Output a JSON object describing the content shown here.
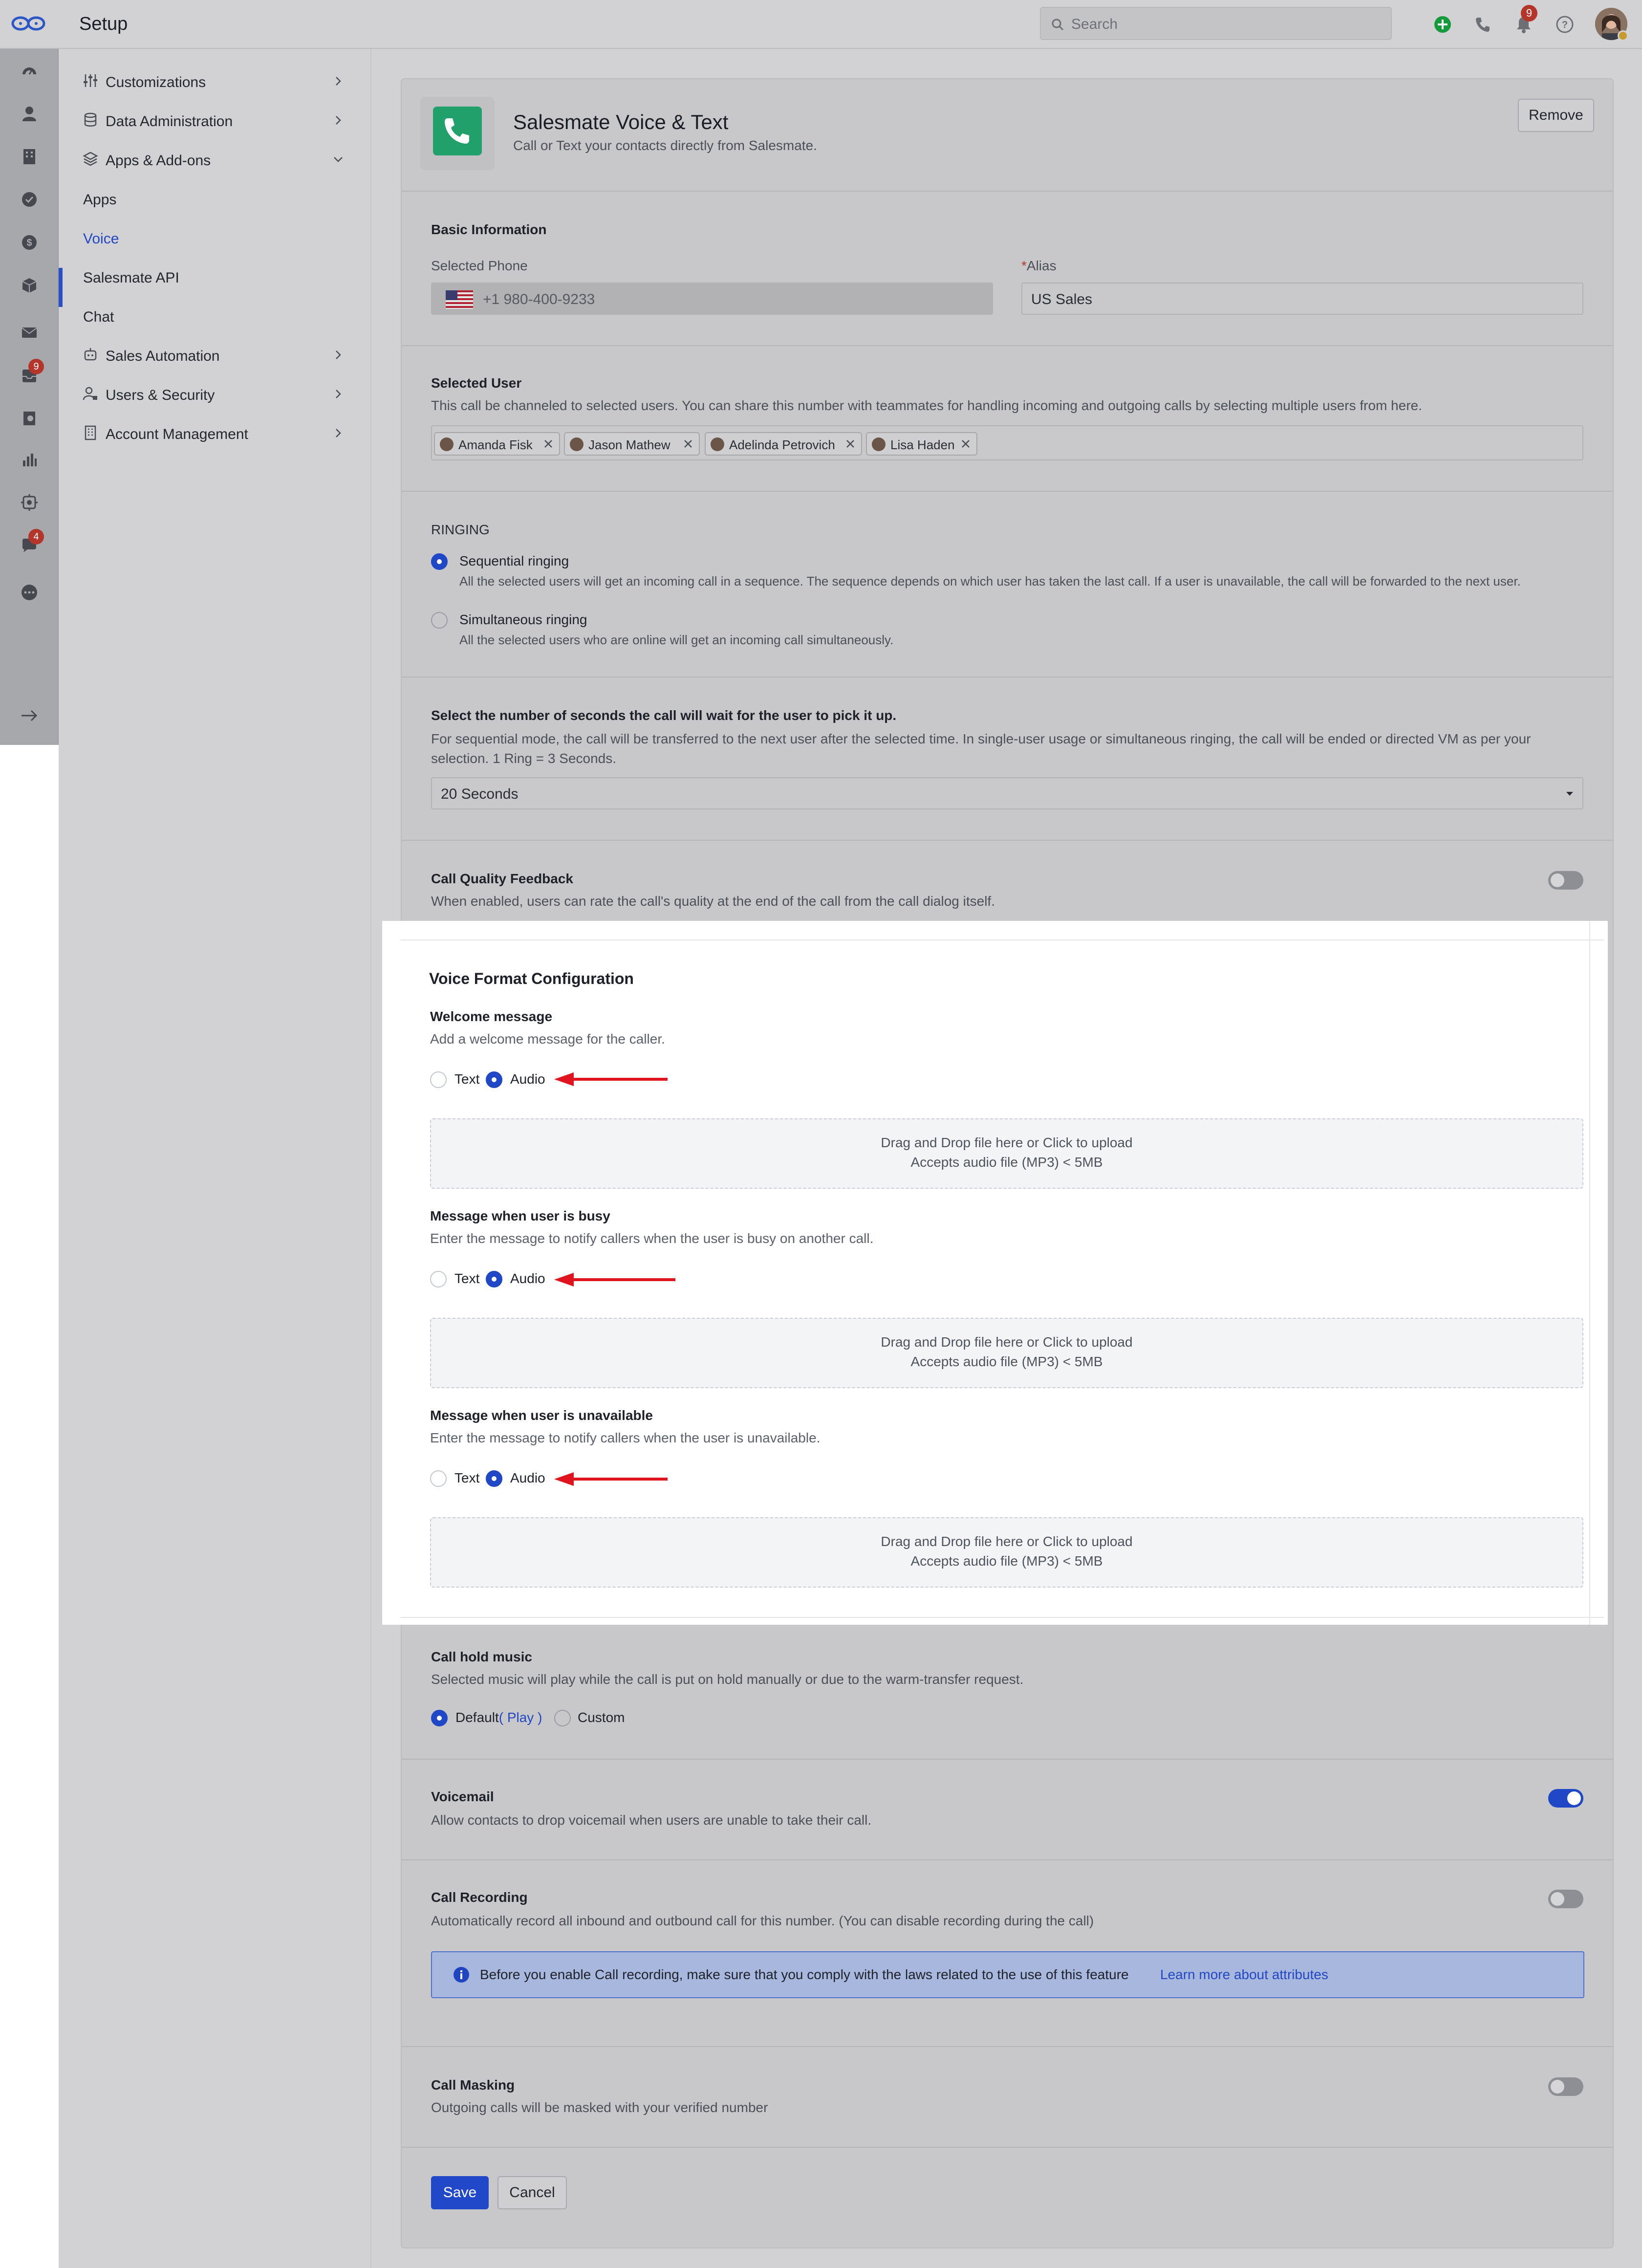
{
  "header": {
    "title": "Setup",
    "search_placeholder": "Search",
    "notification_count": "9"
  },
  "rail": {
    "badges": {
      "mail_count": "9",
      "chat_count": "4"
    }
  },
  "nav": {
    "items": [
      {
        "label": "Customizations",
        "icon": "sliders-icon"
      },
      {
        "label": "Data Administration",
        "icon": "database-icon"
      },
      {
        "label": "Apps & Add-ons",
        "icon": "layers-icon"
      },
      {
        "label": "Sales Automation",
        "icon": "robot-icon"
      },
      {
        "label": "Users & Security",
        "icon": "user-lock-icon"
      },
      {
        "label": "Account Management",
        "icon": "building-icon"
      }
    ],
    "sub_items": [
      "Apps",
      "Voice",
      "Salesmate API",
      "Chat"
    ]
  },
  "app": {
    "name": "Salesmate Voice & Text",
    "description": "Call or Text your contacts directly from Salesmate.",
    "remove_label": "Remove",
    "icon_color": "#22a06b"
  },
  "basic_info": {
    "title": "Basic Information",
    "phone_label": "Selected Phone",
    "phone_value": "+1 980-400-9233",
    "alias_required_mark": "*",
    "alias_label": "Alias",
    "alias_value": "US Sales"
  },
  "selected_user": {
    "title": "Selected User",
    "description": "This call be channeled to selected users. You can share this number with teammates for handling incoming and outgoing calls by selecting multiple users from here.",
    "users": [
      "Amanda Fisk",
      "Jason Mathew",
      "Adelinda Petrovich",
      "Lisa Haden"
    ]
  },
  "ringing": {
    "title": "RINGING",
    "options": [
      {
        "label": "Sequential ringing",
        "description": "All the selected users will get an incoming call in a sequence. The sequence depends on which user has taken the last call. If a user is unavailable, the call will be forwarded to the next user.",
        "selected": true
      },
      {
        "label": "Simultaneous ringing",
        "description": "All the selected users who are online will get an incoming call simultaneously.",
        "selected": false
      }
    ]
  },
  "wait_time": {
    "title": "Select the number of seconds the call will wait for the user to pick it up.",
    "description_line1": "For sequential mode, the call will be transferred to the next user after the selected time. In single-user usage or simultaneous ringing, the call will be ended or directed VM as per your",
    "description_line2": "selection. 1 Ring = 3 Seconds.",
    "selected": "20 Seconds"
  },
  "call_quality": {
    "title": "Call Quality Feedback",
    "description": "When enabled, users can rate the call's quality at the end of the call from the call dialog itself.",
    "enabled": false
  },
  "voice_format": {
    "title": "Voice Format Configuration",
    "text_label": "Text",
    "audio_label": "Audio",
    "dropzone_line1": "Drag and Drop file here or Click to upload",
    "dropzone_line2": "Accepts audio file (MP3) < 5MB",
    "messages": [
      {
        "title": "Welcome message",
        "description": "Add a welcome message for the caller.",
        "selected": "Audio"
      },
      {
        "title": "Message when user is busy",
        "description": "Enter the message to notify callers when the user is busy on another call.",
        "selected": "Audio"
      },
      {
        "title": "Message when user is unavailable",
        "description": "Enter the message to notify callers when the user is unavailable.",
        "selected": "Audio"
      }
    ],
    "annotation_color": "#e0141e"
  },
  "hold_music": {
    "title": "Call hold music",
    "description": "Selected music will play while the call is put on hold manually or due to the warm-transfer request.",
    "default_label": "Default",
    "play_open": "(",
    "play_label": "Play",
    "play_close": ")",
    "custom_label": "Custom",
    "selected": "Default"
  },
  "voicemail": {
    "title": "Voicemail",
    "description": "Allow contacts to drop voicemail when users are unable to take their call.",
    "enabled": true
  },
  "recording": {
    "title": "Call Recording",
    "description": "Automatically record all inbound and outbound call for this number. (You can disable recording during the call)",
    "enabled": false,
    "info_text": "Before you enable Call recording, make sure that you comply with the laws related to the use of this feature",
    "info_link": "Learn more about attributes"
  },
  "masking": {
    "title": "Call Masking",
    "description": "Outgoing calls will be masked with your verified number",
    "enabled": false
  },
  "footer": {
    "save_label": "Save",
    "cancel_label": "Cancel"
  },
  "colors": {
    "primary": "#2148c9",
    "overlay": "#c8c8ca",
    "highlight": "#ffffff"
  }
}
